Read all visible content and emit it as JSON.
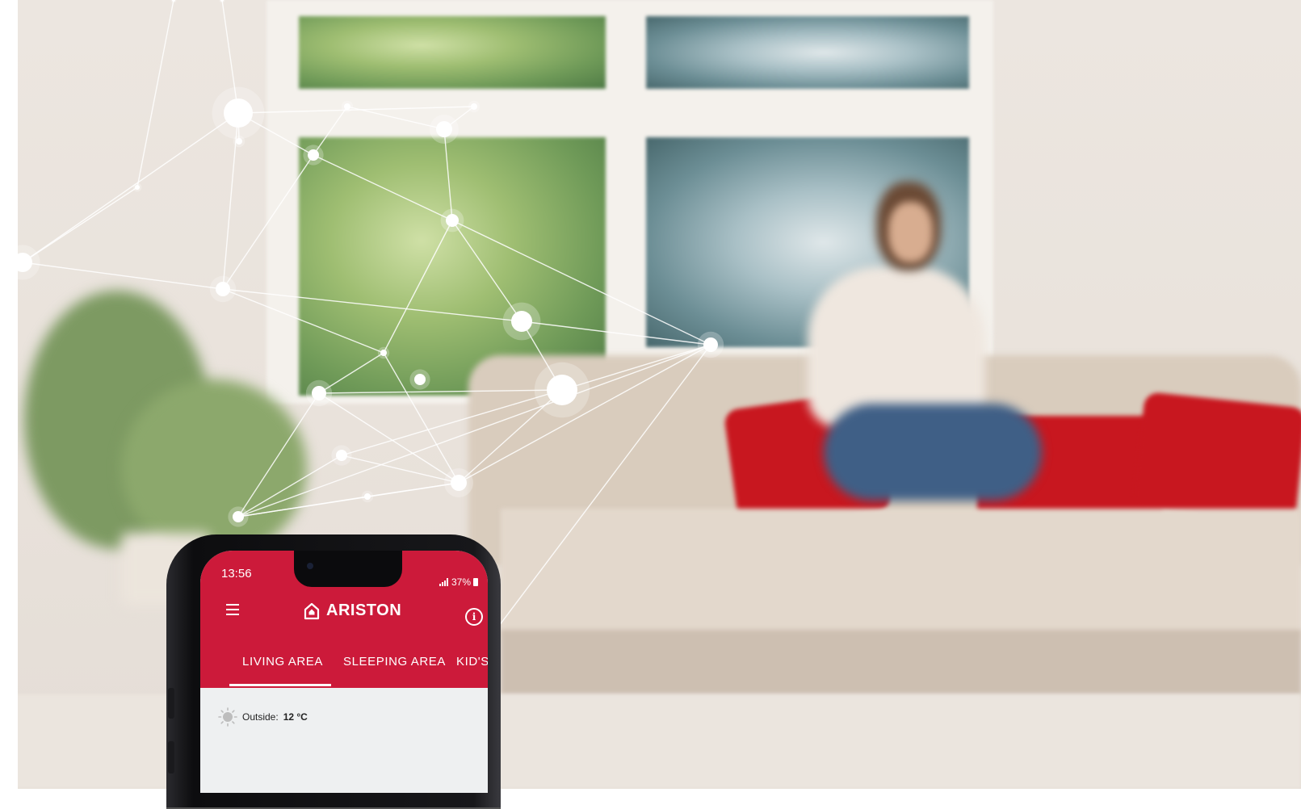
{
  "status_bar": {
    "time": "13:56",
    "battery": "37%"
  },
  "app_header": {
    "brand": "ARISTON"
  },
  "tabs": [
    {
      "label": "LIVING AREA",
      "active": true
    },
    {
      "label": "SLEEPING AREA",
      "active": false
    },
    {
      "label": "KID'S",
      "active": false
    }
  ],
  "weather": {
    "label": "Outside:",
    "value": "12 °C"
  },
  "colors": {
    "brand_red": "#cc1a3a",
    "screen_bg": "#eef0f1"
  },
  "icons": {
    "menu": "hamburger-menu-icon",
    "home": "house-icon",
    "info": "info-icon",
    "weather": "sun-icon",
    "signal": "signal-icon",
    "battery": "battery-icon"
  }
}
